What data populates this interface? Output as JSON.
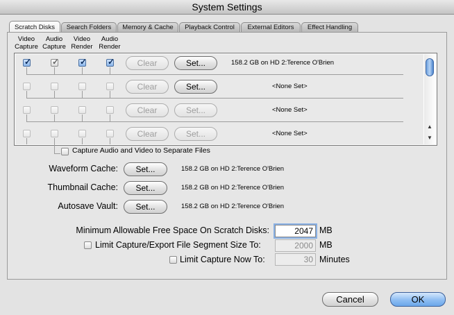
{
  "window": {
    "title": "System Settings"
  },
  "tabs": [
    {
      "label": "Scratch Disks",
      "active": true
    },
    {
      "label": "Search Folders"
    },
    {
      "label": "Memory & Cache"
    },
    {
      "label": "Playback Control"
    },
    {
      "label": "External Editors"
    },
    {
      "label": "Effect Handling"
    }
  ],
  "columns": [
    {
      "line1": "Video",
      "line2": "Capture"
    },
    {
      "line1": "Audio",
      "line2": "Capture"
    },
    {
      "line1": "Video",
      "line2": "Render"
    },
    {
      "line1": "Audio",
      "line2": "Render"
    }
  ],
  "scratch_rows": [
    {
      "checks": [
        true,
        true,
        true,
        true
      ],
      "clear_label": "Clear",
      "set_label": "Set...",
      "path": "158.2 GB on  HD 2:Terence O'Brien",
      "set_enabled": true
    },
    {
      "checks": [
        false,
        false,
        false,
        false
      ],
      "clear_label": "Clear",
      "set_label": "Set...",
      "path": "<None Set>",
      "set_enabled": true
    },
    {
      "checks": [
        false,
        false,
        false,
        false
      ],
      "clear_label": "Clear",
      "set_label": "Set...",
      "path": "<None Set>",
      "set_enabled": false
    },
    {
      "checks": [
        false,
        false,
        false,
        false
      ],
      "clear_label": "Clear",
      "set_label": "Set...",
      "path": "<None Set>",
      "set_enabled": false
    }
  ],
  "separate_files": {
    "label": "Capture Audio and Video to Separate Files",
    "checked": false
  },
  "caches": [
    {
      "label": "Waveform Cache:",
      "set_label": "Set...",
      "path": "158.2 GB on  HD 2:Terence O'Brien"
    },
    {
      "label": "Thumbnail Cache:",
      "set_label": "Set...",
      "path": "158.2 GB on  HD 2:Terence O'Brien"
    },
    {
      "label": "Autosave Vault:",
      "set_label": "Set...",
      "path": "158.2 GB on  HD 2:Terence O'Brien"
    }
  ],
  "limits": {
    "min_free": {
      "label": "Minimum Allowable Free Space On Scratch Disks:",
      "value": "2047",
      "unit": "MB"
    },
    "segment": {
      "label": "Limit Capture/Export File Segment Size To:",
      "value": "2000",
      "unit": "MB",
      "checked": false
    },
    "capture_now": {
      "label": "Limit Capture Now To:",
      "value": "30",
      "unit": "Minutes",
      "checked": false
    }
  },
  "buttons": {
    "cancel": "Cancel",
    "ok": "OK"
  },
  "colors": {
    "accent": "#6ba7ea",
    "focus": "#88b0e4"
  }
}
